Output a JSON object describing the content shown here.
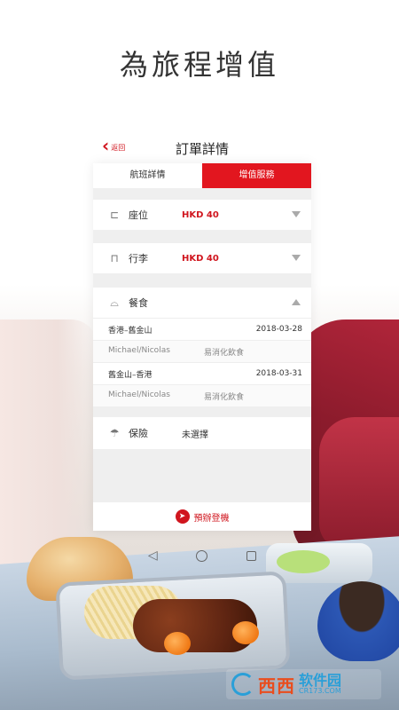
{
  "headline": "為旅程增值",
  "header": {
    "back_label": "返回",
    "title": "訂單詳情"
  },
  "tabs": [
    {
      "label": "航班詳情",
      "active": false
    },
    {
      "label": "增值服務",
      "active": true
    }
  ],
  "services": {
    "seat": {
      "label": "座位",
      "value": "HKD 40",
      "icon": "seat-icon"
    },
    "baggage": {
      "label": "行李",
      "value": "HKD 40",
      "icon": "luggage-icon"
    },
    "meal": {
      "label": "餐食",
      "icon": "meal-cloche-icon",
      "legs": [
        {
          "route": "香港–舊金山",
          "date": "2018-03-28",
          "passenger": "Michael/Nicolas",
          "meal": "易消化飲食"
        },
        {
          "route": "舊金山–香港",
          "date": "2018-03-31",
          "passenger": "Michael/Nicolas",
          "meal": "易消化飲食"
        }
      ]
    },
    "insurance": {
      "label": "保險",
      "value": "未選擇",
      "icon": "umbrella-icon"
    }
  },
  "checkin_button": {
    "label": "預辦登機",
    "icon": "plane-icon"
  },
  "watermark": {
    "name": "西西",
    "site": "软件园",
    "url": "CR173.COM"
  },
  "colors": {
    "accent": "#e2161f",
    "background": "#efefef"
  }
}
